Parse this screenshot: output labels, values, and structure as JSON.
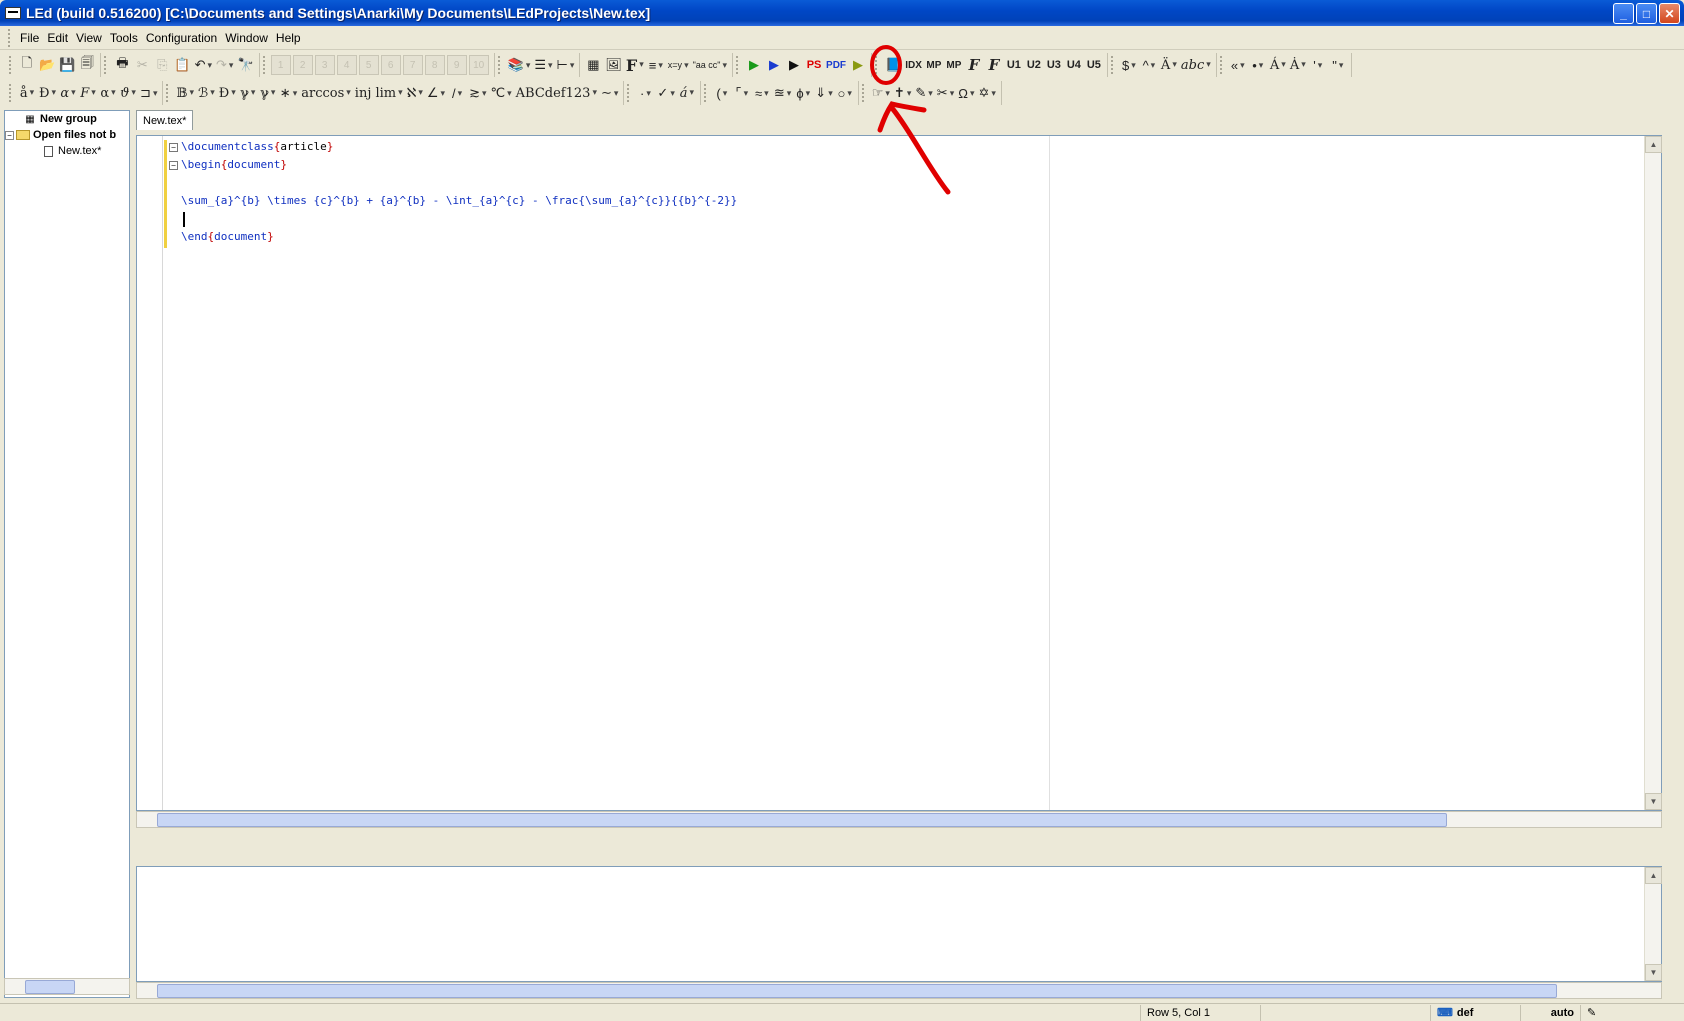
{
  "window": {
    "title": "LEd (build 0.516200) [C:\\Documents and Settings\\Anarki\\My Documents\\LEdProjects\\New.tex]",
    "minimize": "_",
    "maximize": "□",
    "close": "✕"
  },
  "menu": [
    "File",
    "Edit",
    "View",
    "Tools",
    "Configuration",
    "Window",
    "Help"
  ],
  "toolbar1": {
    "numbered_buttons": [
      "1",
      "2",
      "3",
      "4",
      "5",
      "6",
      "7",
      "8",
      "9",
      "10"
    ],
    "bold_F": "F",
    "xy_label": "x=y",
    "aa_label": "\"aa cc\"",
    "ps_label": "PS",
    "pdf_label": "PDF",
    "idx_label": "IDX",
    "mp_label_1": "MP",
    "mp_label_2": "MP",
    "f_label_1": "F",
    "f_label_2": "F",
    "u_buttons": [
      "U1",
      "U2",
      "U3",
      "U4",
      "U5"
    ],
    "dollar": "$",
    "caret": "^",
    "a_umlaut": "Ä",
    "abc": "abc",
    "guillemet": "«",
    "bullet": "•",
    "a_acute": "Á",
    "a_dot": "Ȧ",
    "quote_single": "'",
    "quote_double": "\""
  },
  "toolbar2": {
    "a_ring": "å",
    "eth": "Ð",
    "alpha_script": "α",
    "f_script": "F",
    "alpha": "α",
    "theta_script": "ϑ",
    "box_b": "𝔹",
    "curly": "ℬ",
    "d_cal": "Ɖ",
    "v_sym1": "ℽ",
    "v_sym2": "ℽ",
    "star": "∗",
    "arccos": "arccos",
    "injlim": "inj lim",
    "aleph": "ℵ",
    "angle": "∠",
    "slash": "/",
    "geq": "≳",
    "celsius": "℃",
    "abcdef": "ABCdef123",
    "tilde": "∼",
    "dot": "·",
    "check": "✓",
    "a_acute_small": "á",
    "paren": "(",
    "corner": "⌜",
    "approx": "≈",
    "approx2": "≊",
    "phi": "ϕ",
    "down_arrow": "⇓",
    "circle": "○",
    "hand": "☞",
    "cross": "✝",
    "pencil": "✎",
    "scissors": "✂",
    "omega": "Ω",
    "star6": "✡"
  },
  "tree": {
    "group_label": "New group",
    "open_files_label": "Open files not b",
    "file_label": "New.tex*"
  },
  "editor": {
    "tab_label": "New.tex*",
    "lines": {
      "l1_cmd": "\\documentclass",
      "l1_open": "{",
      "l1_arg": "article",
      "l1_close": "}",
      "l2_cmd": "\\begin",
      "l2_open": "{",
      "l2_arg": "document",
      "l2_close": "}",
      "l4": "\\sum_{a}^{b} \\times {c}^{b} + {a}^{b} - \\int_{a}^{c} - \\frac{\\sum_{a}^{c}}{{b}^{-2}}",
      "l6_cmd": "\\end",
      "l6_open": "{",
      "l6_arg": "document",
      "l6_close": "}"
    }
  },
  "status": {
    "position": "Row 5, Col 1",
    "def_label": "def",
    "auto_label": "auto"
  },
  "colors": {
    "title_bar": "#0047c6",
    "keyword": "#1030c0",
    "brace": "#c00000",
    "annotation": "#e00000"
  }
}
